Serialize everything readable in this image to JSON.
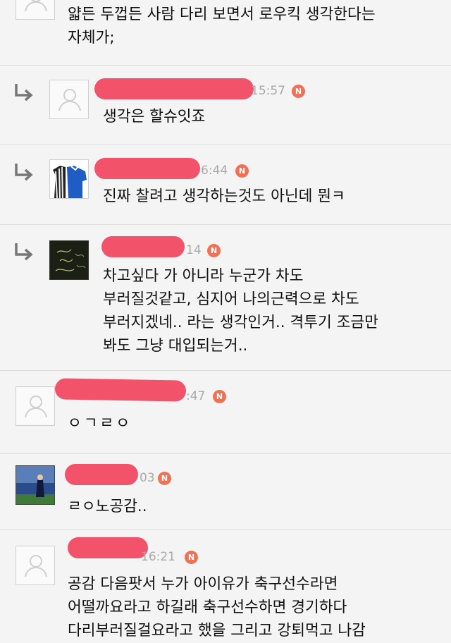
{
  "comments": [
    {
      "text": "얇든 두껍든 사람 다리 보면서 로우킥 생각한다는\n자체가;"
    },
    {
      "time": "15:57",
      "badge": "N",
      "text": "생각은 할슈잇죠"
    },
    {
      "time": "6:44",
      "badge": "N",
      "text": "진짜 찰려고 생각하는것도 아닌데 뭔ㅋ"
    },
    {
      "time": "14",
      "badge": "N",
      "text": "차고싶다 가 아니라 누군가 차도\n부러질것같고, 심지어 나의근력으로 차도\n부러지겠네.. 라는 생각인거.. 격투기 조금만\n봐도 그냥 대입되는거.."
    },
    {
      "time": ":47",
      "badge": "N",
      "text": "ㅇㄱㄹㅇ"
    },
    {
      "time": "03",
      "badge": "N",
      "text": "ㄹㅇ노공감.."
    },
    {
      "time": "16:21",
      "badge": "N",
      "text": "공감 다음팟서 누가 아이유가 축구선수라면\n어떨까요라고 하길래 축구선수하면 경기하다\n다리부러질걸요라고 했을 그리고 강퇴먹고 나감"
    }
  ],
  "colors": {
    "badge": "#ef7257",
    "redaction": "#f2526a",
    "divider": "#dcdcdc"
  }
}
